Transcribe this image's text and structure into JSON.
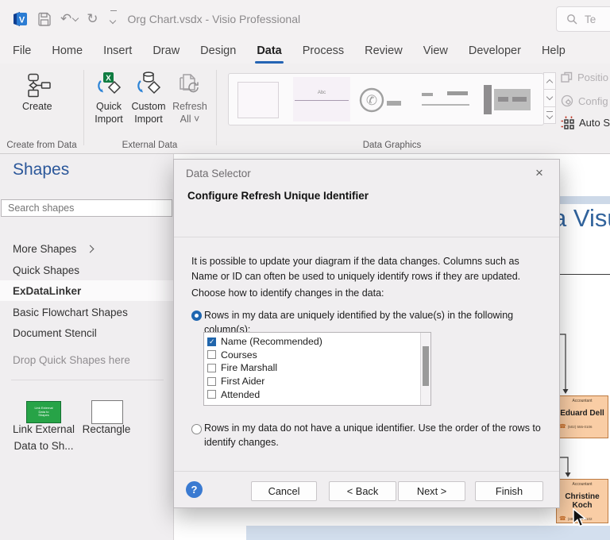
{
  "titlebar": {
    "title": "Org Chart.vsdx - Visio Professional",
    "search_text": "Te"
  },
  "menubar": {
    "items": [
      "File",
      "Home",
      "Insert",
      "Draw",
      "Design",
      "Data",
      "Process",
      "Review",
      "View",
      "Developer",
      "Help"
    ],
    "active_item": "Data"
  },
  "ribbon": {
    "create": {
      "button_label": "Create",
      "group_label": "Create from Data"
    },
    "external": {
      "quick": "Quick\nImport",
      "custom": "Custom\nImport",
      "refresh": "Refresh\nAll ˅",
      "group_label": "External Data"
    },
    "data_graphics": {
      "group_label": "Data Graphics",
      "abc": "Abc"
    },
    "right": {
      "position": "Positio",
      "configure": "Config",
      "autosize": "Auto S"
    }
  },
  "left_panel": {
    "heading": "Shapes",
    "search_placeholder": "Search shapes",
    "more_shapes": "More Shapes",
    "items": [
      "Quick Shapes",
      "ExDataLinker",
      "Basic Flowchart Shapes",
      "Document Stencil"
    ],
    "active_item": "ExDataLinker",
    "drop_hint": "Drop Quick Shapes here",
    "stencil": [
      {
        "label": "Link External\nData to Sh...",
        "mini": "Link External\nData to\nShapes"
      },
      {
        "label": "Rectangle"
      }
    ]
  },
  "dialog": {
    "title": "Data Selector",
    "close_glyph": "×",
    "heading": "Configure Refresh Unique Identifier",
    "intro": "It is possible to update your diagram if the data changes. Columns such as Name or ID can often be used to uniquely identify rows if they are updated.",
    "choose_label": "Choose how to identify changes in the data:",
    "radio1": "Rows in my data are uniquely identified by the value(s) in the following column(s):",
    "radio2": "Rows in my data do not have a unique identifier. Use the order of the rows to identify changes.",
    "columns": [
      {
        "label": "Name (Recommended)",
        "checked": true
      },
      {
        "label": "Courses",
        "checked": false
      },
      {
        "label": "Fire Marshall",
        "checked": false
      },
      {
        "label": "First Aider",
        "checked": false
      },
      {
        "label": "Attended",
        "checked": false
      }
    ],
    "buttons": {
      "cancel": "Cancel",
      "back": "< Back",
      "next": "Next >",
      "finish": "Finish"
    },
    "help_glyph": "?"
  },
  "canvas": {
    "heading_fragment": "a Visu",
    "shapes": [
      {
        "role": "Accountant",
        "name": "Eduard Dell",
        "phone": "(502) 555-0106"
      },
      {
        "role": "Accountant",
        "name": "Christine Koch",
        "phone": "(480) 555-0102"
      }
    ]
  },
  "colors": {
    "accent_blue": "#2b579a",
    "selection_blue": "#1f66b0",
    "org_fill": "#f9cda5",
    "org_border": "#bc7b43",
    "heading_blue": "#31639c"
  }
}
